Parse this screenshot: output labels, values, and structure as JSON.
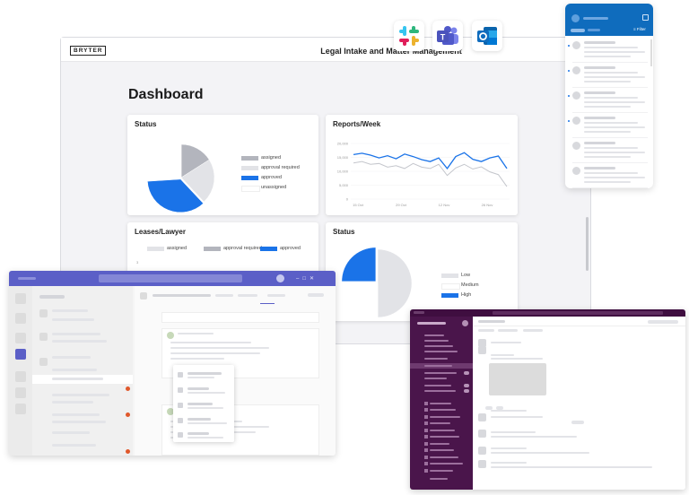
{
  "app": {
    "brand": "BRYTER",
    "title": "Legal Intake and Matter Management",
    "page_title": "Dashboard"
  },
  "apps": [
    {
      "name": "slack-icon"
    },
    {
      "name": "teams-icon"
    },
    {
      "name": "outlook-icon"
    }
  ],
  "cards": {
    "status": {
      "title": "Status"
    },
    "reports": {
      "title": "Reports/Week"
    },
    "leases": {
      "title": "Leases/Lawyer"
    },
    "status2": {
      "title": "Status"
    }
  },
  "outlook": {
    "filter_label": "Filter"
  },
  "colors": {
    "accent": "#1a73e8",
    "grey": "#b9bbc2",
    "light": "#e4e5e9",
    "teams": "#5b5fc7",
    "slack": "#4a154b"
  },
  "chart_data": [
    {
      "type": "pie",
      "title": "Status",
      "series": [
        {
          "name": "assigned",
          "value": 16,
          "color": "#b3b5bd"
        },
        {
          "name": "approval required",
          "value": 22,
          "color": "#e2e3e7"
        },
        {
          "name": "approved",
          "value": 36,
          "color": "#1a73e8"
        },
        {
          "name": "unassigned",
          "value": 26,
          "color": "#ffffff"
        }
      ]
    },
    {
      "type": "line",
      "title": "Reports/Week",
      "y_ticks": [
        "20,000",
        "15,000",
        "10,000",
        "5,000",
        "0"
      ],
      "x_ticks": [
        "15 Oct",
        "29 Oct",
        "12 Nov",
        "26 Nov"
      ],
      "ylim": [
        0,
        20000
      ],
      "series": [
        {
          "color": "#1a73e8",
          "values": [
            16000,
            16500,
            15800,
            14800,
            15600,
            14500,
            16200,
            15300,
            14200,
            13500,
            14800,
            11000,
            15300,
            16700,
            14300,
            13500,
            14800,
            15500,
            11000
          ]
        },
        {
          "color": "#c4c6cc",
          "values": [
            13000,
            13500,
            12500,
            12800,
            11500,
            12000,
            11000,
            12800,
            11500,
            11000,
            12500,
            8500,
            11200,
            12500,
            10800,
            11600,
            9800,
            8800,
            4500
          ]
        }
      ]
    },
    {
      "type": "bar",
      "title": "Leases/Lawyer",
      "series": [
        {
          "name": "assigned",
          "color": "#e2e3e7"
        },
        {
          "name": "approval required",
          "color": "#b3b5bd"
        },
        {
          "name": "approved",
          "color": "#1a73e8"
        }
      ]
    },
    {
      "type": "pie",
      "title": "Status",
      "series": [
        {
          "name": "Low",
          "value": 50,
          "color": "#e2e3e7"
        },
        {
          "name": "Medium",
          "value": 25,
          "color": "#ffffff"
        },
        {
          "name": "High",
          "value": 25,
          "color": "#1a73e8"
        }
      ]
    }
  ]
}
